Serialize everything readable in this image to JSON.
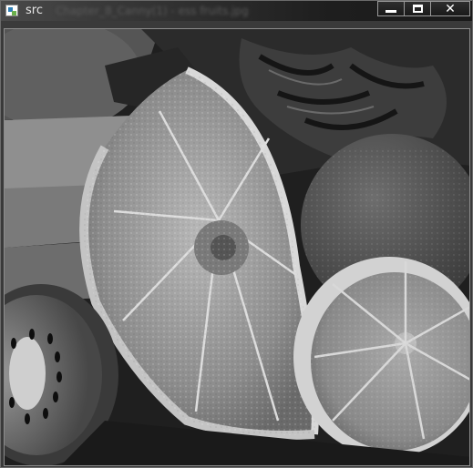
{
  "window": {
    "title": "src",
    "background_title_text": "Chapter_8_Canny(1) - ess fruits.jpg",
    "controls": {
      "minimize_icon": "minimize-icon",
      "maximize_icon": "maximize-icon",
      "close_icon": "close-icon"
    }
  },
  "image": {
    "description_name": "fruits-grayscale-image",
    "colors": {
      "background": "#1e1e1e",
      "orange_slice": "#9a9a9a",
      "lemon": "#8f8f8f"
    }
  }
}
